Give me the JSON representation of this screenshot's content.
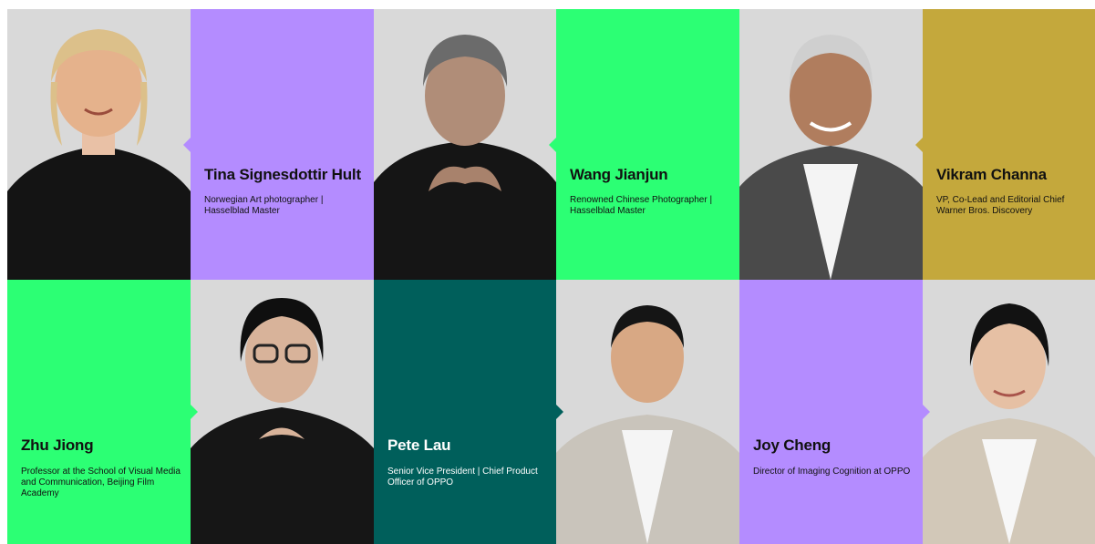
{
  "colors": {
    "purple": "#b48cff",
    "green": "#2cff74",
    "gold": "#c4a83c",
    "teal": "#005f5b",
    "photo_bg": "#d9d9d9",
    "dark_clothing": "#1a1a1a"
  },
  "people": [
    {
      "name": "Tina Signesdottir Hult",
      "title": "Norwegian Art photographer | Hasselblad Master"
    },
    {
      "name": "Wang Jianjun",
      "title": "Renowned Chinese Photographer | Hasselblad Master"
    },
    {
      "name": "Vikram Channa",
      "title": "VP, Co-Lead and Editorial Chief Warner Bros. Discovery"
    },
    {
      "name": "Zhu Jiong",
      "title": "Professor at the School of Visual Media and Communication, Beijing Film Academy"
    },
    {
      "name": "Pete Lau",
      "title": "Senior Vice President | Chief Product Officer of OPPO"
    },
    {
      "name": "Joy Cheng",
      "title": "Director of Imaging Cognition at OPPO"
    }
  ],
  "portraits": [
    {
      "subject": "portrait of Tina Signesdottir Hult"
    },
    {
      "subject": "portrait of Wang Jianjun"
    },
    {
      "subject": "portrait of Vikram Channa"
    },
    {
      "subject": "portrait of Zhu Jiong"
    },
    {
      "subject": "portrait of Pete Lau"
    },
    {
      "subject": "portrait of Joy Cheng"
    }
  ]
}
